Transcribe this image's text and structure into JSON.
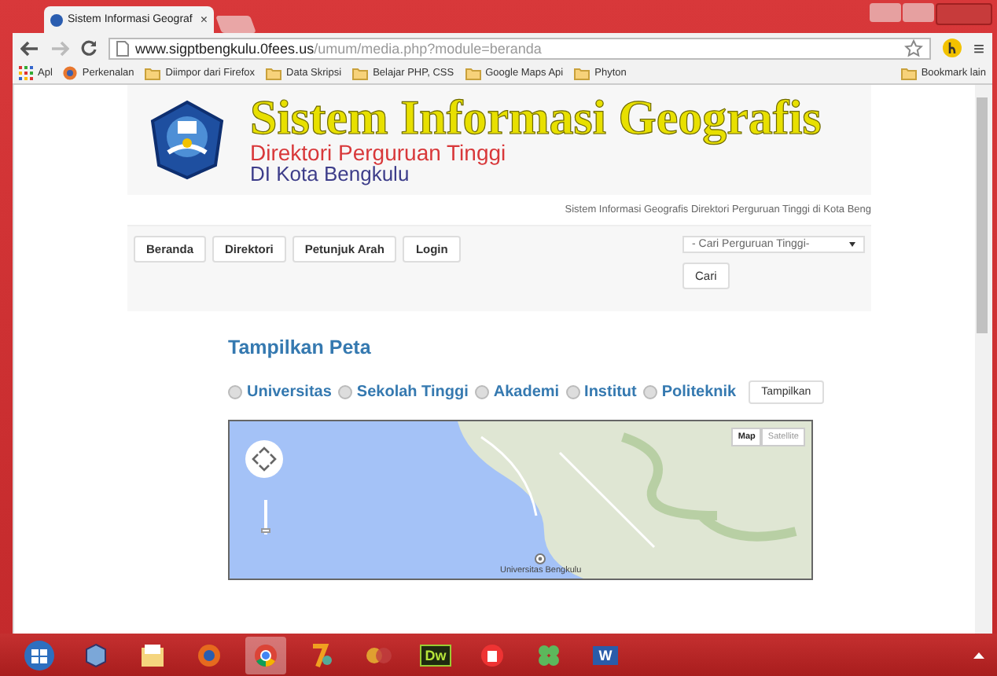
{
  "browser": {
    "tab_title": "Sistem Informasi Geograf",
    "tab_close": "×",
    "url_host": "www.sigptbengkulu.0fees.us",
    "url_path": "/umum/media.php?module=beranda",
    "menu_glyph": "≡"
  },
  "bookmarks": [
    {
      "label": "Apl",
      "kind": "apps"
    },
    {
      "label": "Perkenalan",
      "kind": "site"
    },
    {
      "label": "Diimpor dari Firefox",
      "kind": "folder"
    },
    {
      "label": "Data Skripsi",
      "kind": "folder"
    },
    {
      "label": "Belajar PHP, CSS",
      "kind": "folder"
    },
    {
      "label": "Google Maps Api",
      "kind": "folder"
    },
    {
      "label": "Phyton",
      "kind": "folder"
    }
  ],
  "other_bookmarks": "Bookmark lain",
  "header": {
    "title": "Sistem Informasi Geografis",
    "subtitle": "Direktori Perguruan Tinggi",
    "location": "DI Kota Bengkulu",
    "tagline": "Sistem Informasi Geografis Direktori Perguruan Tinggi di Kota Beng"
  },
  "nav": [
    "Beranda",
    "Direktori",
    "Petunjuk Arah",
    "Login"
  ],
  "search": {
    "select": "- Cari Perguruan Tinggi-",
    "button": "Cari"
  },
  "section_title": "Tampilkan Peta",
  "filters": [
    {
      "label": "Universitas",
      "selected": false
    },
    {
      "label": "Sekolah Tinggi",
      "selected": false
    },
    {
      "label": "Akademi",
      "selected": false
    },
    {
      "label": "Institut",
      "selected": false
    },
    {
      "label": "Politeknik",
      "selected": false
    }
  ],
  "show_button": "Tampilkan",
  "map": {
    "types": [
      {
        "label": "Map",
        "selected": true
      },
      {
        "label": "Satellite",
        "selected": false
      }
    ],
    "zoom": {
      "level": 0.2
    },
    "marker_label": "Universitas Bengkulu"
  },
  "taskbar": [
    {
      "kind": "start",
      "selected": false
    },
    {
      "kind": "box",
      "selected": false
    },
    {
      "kind": "files",
      "selected": false
    },
    {
      "kind": "firefox",
      "selected": false
    },
    {
      "kind": "chrome",
      "selected": true
    },
    {
      "kind": "zip",
      "selected": false
    },
    {
      "kind": "media",
      "selected": false
    },
    {
      "kind": "text",
      "label": "Dw",
      "selected": false
    },
    {
      "kind": "red",
      "selected": false
    },
    {
      "kind": "clover",
      "selected": false
    },
    {
      "kind": "word",
      "label": "W",
      "selected": false
    }
  ]
}
